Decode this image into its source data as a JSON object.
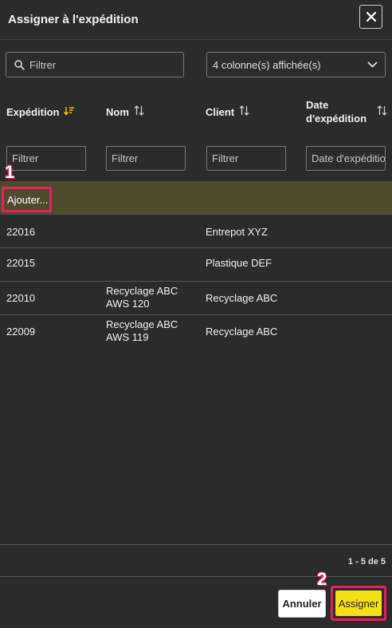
{
  "dialog": {
    "title": "Assigner à l'expédition"
  },
  "toolbar": {
    "search_placeholder": "Filtrer",
    "columns_select": "4 colonne(s) affichée(s)"
  },
  "table": {
    "headers": {
      "expedition": "Expédition",
      "nom": "Nom",
      "client": "Client",
      "date_line1": "Date",
      "date_line2": "d'expédition"
    },
    "filters": {
      "expedition": "Filtrer",
      "nom": "Filtrer",
      "client": "Filtrer",
      "date": "Date d'expédition"
    },
    "add_label": "Ajouter...",
    "rows": [
      {
        "expedition": "22016",
        "nom_line1": "",
        "nom_line2": "",
        "client": "Entrepot XYZ"
      },
      {
        "expedition": "22015",
        "nom_line1": "",
        "nom_line2": "",
        "client": "Plastique DEF"
      },
      {
        "expedition": "22010",
        "nom_line1": "Recyclage ABC",
        "nom_line2": "AWS 120",
        "client": "Recyclage ABC"
      },
      {
        "expedition": "22009",
        "nom_line1": "Recyclage ABC",
        "nom_line2": "AWS 119",
        "client": "Recyclage ABC"
      }
    ]
  },
  "pagination": "1 - 5 de 5",
  "buttons": {
    "cancel": "Annuler",
    "assign": "Assigner"
  },
  "annotations": {
    "badge1": "1",
    "badge2": "2"
  },
  "colors": {
    "accent": "#f5e014",
    "highlight": "#e2245c",
    "selected_row": "#4f4a2b"
  }
}
